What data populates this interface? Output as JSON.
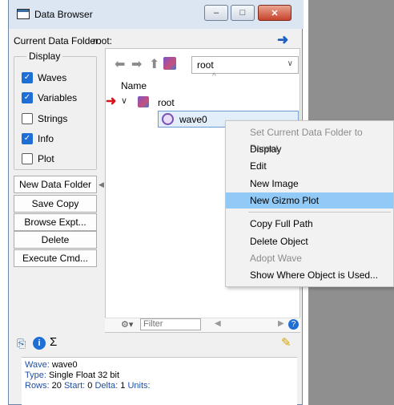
{
  "window": {
    "title": "Data Browser"
  },
  "controls": {
    "minimize": "–",
    "maximize": "□",
    "close": "✕"
  },
  "folder": {
    "label": "Current Data Folder:",
    "value": "root:"
  },
  "display": {
    "legend": "Display",
    "options": [
      {
        "label": "Waves",
        "checked": true
      },
      {
        "label": "Variables",
        "checked": true
      },
      {
        "label": "Strings",
        "checked": false
      },
      {
        "label": "Info",
        "checked": true
      },
      {
        "label": "Plot",
        "checked": false
      }
    ]
  },
  "buttons": [
    "New Data Folder",
    "Save Copy",
    "Browse Expt...",
    "Delete",
    "Execute Cmd..."
  ],
  "navigator": {
    "folder_combo": "root"
  },
  "tree": {
    "column_header": "Name",
    "root_label": "root",
    "wave_label": "wave0"
  },
  "filter": {
    "placeholder": "Filter"
  },
  "info": {
    "wave_key": "Wave:",
    "wave_value": "wave0",
    "type_key": "Type:",
    "type_value": "Single Float 32 bit",
    "rows_key": "Rows:",
    "rows_value": "20",
    "start_key": "Start:",
    "start_value": "0",
    "delta_key": "Delta:",
    "delta_value": "1",
    "units_key": "Units:"
  },
  "context_menu": {
    "items": [
      {
        "label": "Set Current Data Folder to Parent",
        "disabled": true
      },
      {
        "label": "Display"
      },
      {
        "label": "Edit"
      },
      {
        "label": "New Image"
      },
      {
        "label": "New Gizmo Plot",
        "highlighted": true
      },
      {
        "label": "Copy Full Path"
      },
      {
        "label": "Delete Object"
      },
      {
        "label": "Adopt Wave",
        "disabled": true
      },
      {
        "label": "Show Where Object is Used..."
      }
    ]
  },
  "colors": {
    "accent": "#1f6ed6",
    "highlight": "#91c9f7",
    "selection": "#e3eefb",
    "arrow_red": "#d7141a"
  }
}
